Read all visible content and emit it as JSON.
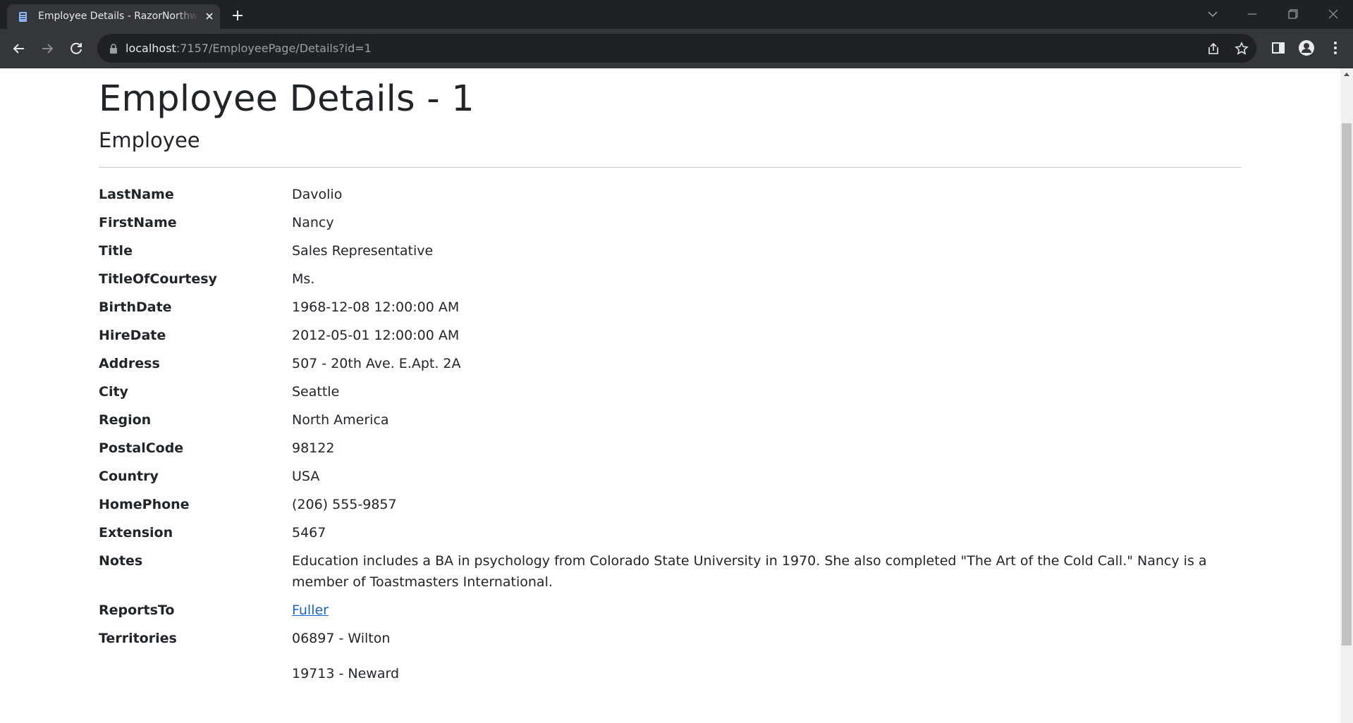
{
  "browser": {
    "tab_title": "Employee Details - RazorNorthwind",
    "url_host": "localhost",
    "url_rest": ":7157/EmployeePage/Details?id=1"
  },
  "page": {
    "title": "Employee Details - 1",
    "section": "Employee",
    "fields": [
      {
        "label": "LastName",
        "value": "Davolio"
      },
      {
        "label": "FirstName",
        "value": "Nancy"
      },
      {
        "label": "Title",
        "value": "Sales Representative"
      },
      {
        "label": "TitleOfCourtesy",
        "value": "Ms."
      },
      {
        "label": "BirthDate",
        "value": "1968-12-08 12:00:00 AM"
      },
      {
        "label": "HireDate",
        "value": "2012-05-01 12:00:00 AM"
      },
      {
        "label": "Address",
        "value": "507 - 20th Ave. E.Apt. 2A"
      },
      {
        "label": "City",
        "value": "Seattle"
      },
      {
        "label": "Region",
        "value": "North America"
      },
      {
        "label": "PostalCode",
        "value": "98122"
      },
      {
        "label": "Country",
        "value": "USA"
      },
      {
        "label": "HomePhone",
        "value": "(206) 555-9857"
      },
      {
        "label": "Extension",
        "value": "5467"
      },
      {
        "label": "Notes",
        "value": "Education includes a BA in psychology from Colorado State University in 1970. She also completed \"The Art of the Cold Call.\" Nancy is a member of Toastmasters International."
      },
      {
        "label": "ReportsTo",
        "value": "Fuller"
      },
      {
        "label": "Territories",
        "value": "06897 - Wilton"
      }
    ],
    "extra_territory": "19713 - Neward"
  }
}
